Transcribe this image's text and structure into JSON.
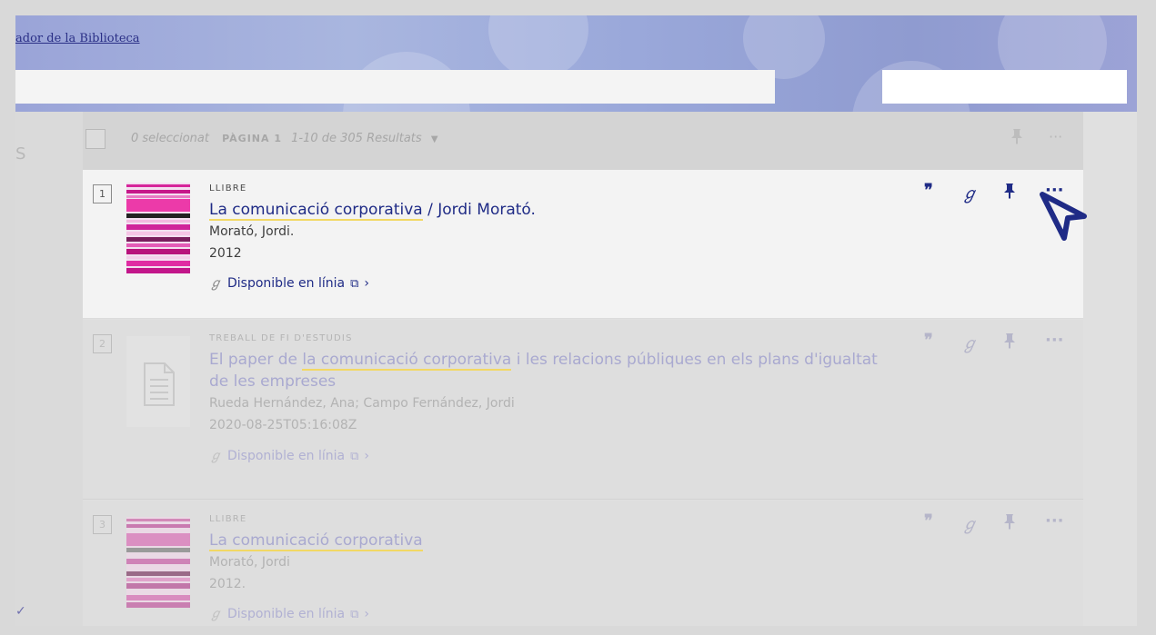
{
  "header": {
    "link_text": "ador de la Biblioteca"
  },
  "leftbar": {
    "letter": "S",
    "bottom_mark": "✓"
  },
  "toolbar": {
    "selected": "0 seleccionat",
    "page": "PÀGINA 1",
    "range": "1-10 de 305 Resultats",
    "caret": "▼",
    "more": "···"
  },
  "records": [
    {
      "number": "1",
      "type": "LLIBRE",
      "title_highlight": "La comunicació corporativa",
      "title_rest": " / Jordi Morató.",
      "author": "Morató, Jordi.",
      "date": "2012",
      "availability": "Disponible en línia"
    },
    {
      "number": "2",
      "type": "TREBALL DE FI D'ESTUDIS",
      "title_pre": "El paper de ",
      "title_highlight": "la comunicació corporativa",
      "title_rest": " i les relacions públiques en els plans d'igualtat de les empreses",
      "author": "Rueda Hernández, Ana; Campo Fernández, Jordi",
      "date": "2020-08-25T05:16:08Z",
      "availability": "Disponible en línia"
    },
    {
      "number": "3",
      "type": "LLIBRE",
      "title_highlight": "La comunicació corporativa",
      "author": "Morató, Jordi",
      "date": "2012.",
      "availability": "Disponible en línia"
    }
  ],
  "icons": {
    "quote": "❞",
    "link": "ℊ",
    "more": "···",
    "link_prefix": "ℊ",
    "external": "⧉",
    "chevron": "›"
  },
  "colors": {
    "primary": "#1f2b86",
    "highlight": "#f2d864"
  }
}
